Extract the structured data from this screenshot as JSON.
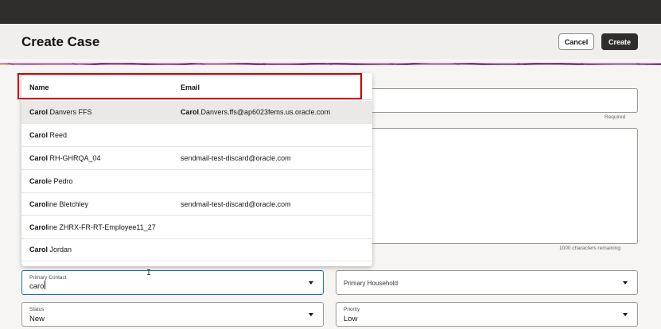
{
  "page": {
    "title": "Create Case",
    "cancel_label": "Cancel",
    "create_label": "Create"
  },
  "form": {
    "subject_required": "Required",
    "chars_remaining": "1000 characters remaining",
    "primary_contact": {
      "label": "Primary Contact",
      "value": "caro"
    },
    "primary_household": {
      "placeholder": "Primary Household"
    },
    "status": {
      "label": "Status",
      "value": "New"
    },
    "priority": {
      "label": "Priority",
      "value": "Low"
    }
  },
  "dropdown": {
    "columns": {
      "name": "Name",
      "email": "Email"
    },
    "rows": [
      {
        "name_match": "Carol",
        "name_rest": " Danvers FFS",
        "email_match": "Carol",
        "email_rest": ".Danvers.ffs@ap6023fems.us.oracle.com"
      },
      {
        "name_match": "Carol",
        "name_rest": " Reed",
        "email_match": "",
        "email_rest": ""
      },
      {
        "name_match": "Carol",
        "name_rest": " RH-GHRQA_04",
        "email_match": "",
        "email_rest": "sendmail-test-discard@oracle.com"
      },
      {
        "name_match": "Carol",
        "name_rest": "e Pedro",
        "email_match": "",
        "email_rest": ""
      },
      {
        "name_match": "Carol",
        "name_rest": "ine Bletchley",
        "email_match": "",
        "email_rest": "sendmail-test-discard@oracle.com"
      },
      {
        "name_match": "Carol",
        "name_rest": "ine ZHRX-FR-RT-Employee11_27",
        "email_match": "",
        "email_rest": ""
      },
      {
        "name_match": "Carol",
        "name_rest": " Jordan",
        "email_match": "",
        "email_rest": ""
      }
    ]
  },
  "colors": {
    "topbar": "#312d2a",
    "primary_button": "#312d2a",
    "focus_border": "#1f6fa6",
    "highlight_box": "#d20000"
  }
}
